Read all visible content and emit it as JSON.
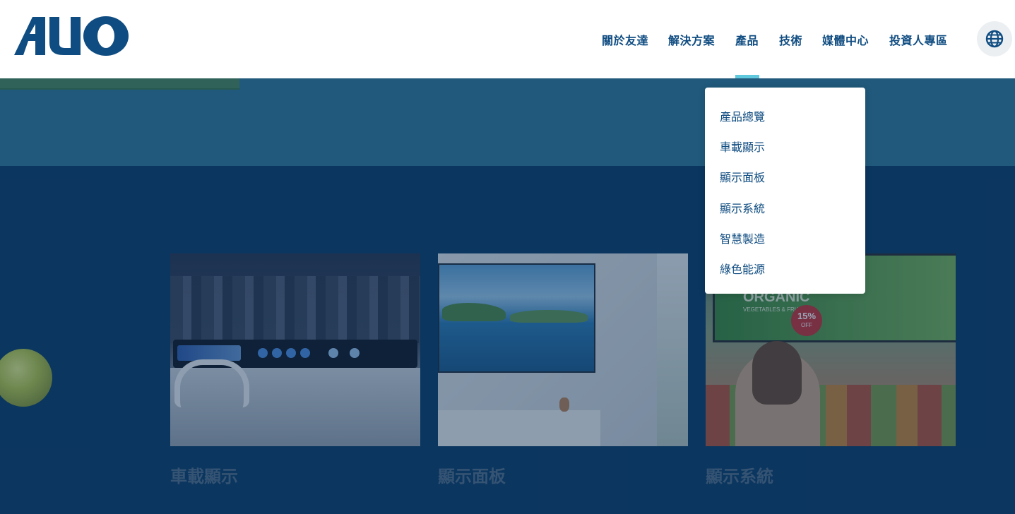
{
  "header": {
    "logo_text": "AUO",
    "nav": [
      {
        "label": "關於友達"
      },
      {
        "label": "解決方案"
      },
      {
        "label": "產品"
      },
      {
        "label": "技術"
      },
      {
        "label": "媒體中心"
      },
      {
        "label": "投資人專區"
      }
    ],
    "active_nav": "產品",
    "language_icon": "globe-icon"
  },
  "dropdown": {
    "items": [
      {
        "label": "產品總覽"
      },
      {
        "label": "車載顯示"
      },
      {
        "label": "顯示面板"
      },
      {
        "label": "顯示系統"
      },
      {
        "label": "智慧製造"
      },
      {
        "label": "綠色能源"
      }
    ]
  },
  "cards": [
    {
      "title": "車載顯示",
      "image": "car-interior-display"
    },
    {
      "title": "顯示面板",
      "image": "wall-tv-panel"
    },
    {
      "title": "顯示系統",
      "image": "grocery-signage",
      "sign_text": "ORGANIC",
      "sign_subtext": "VEGETABLES & FRUITS",
      "badge_text": "15%",
      "badge_subtext": "OFF"
    }
  ],
  "colors": {
    "brand_blue": "#0f4c81",
    "accent_cyan": "#5fc8dc",
    "page_bg": "#0d3e69",
    "band_teal": "#317a9a"
  }
}
